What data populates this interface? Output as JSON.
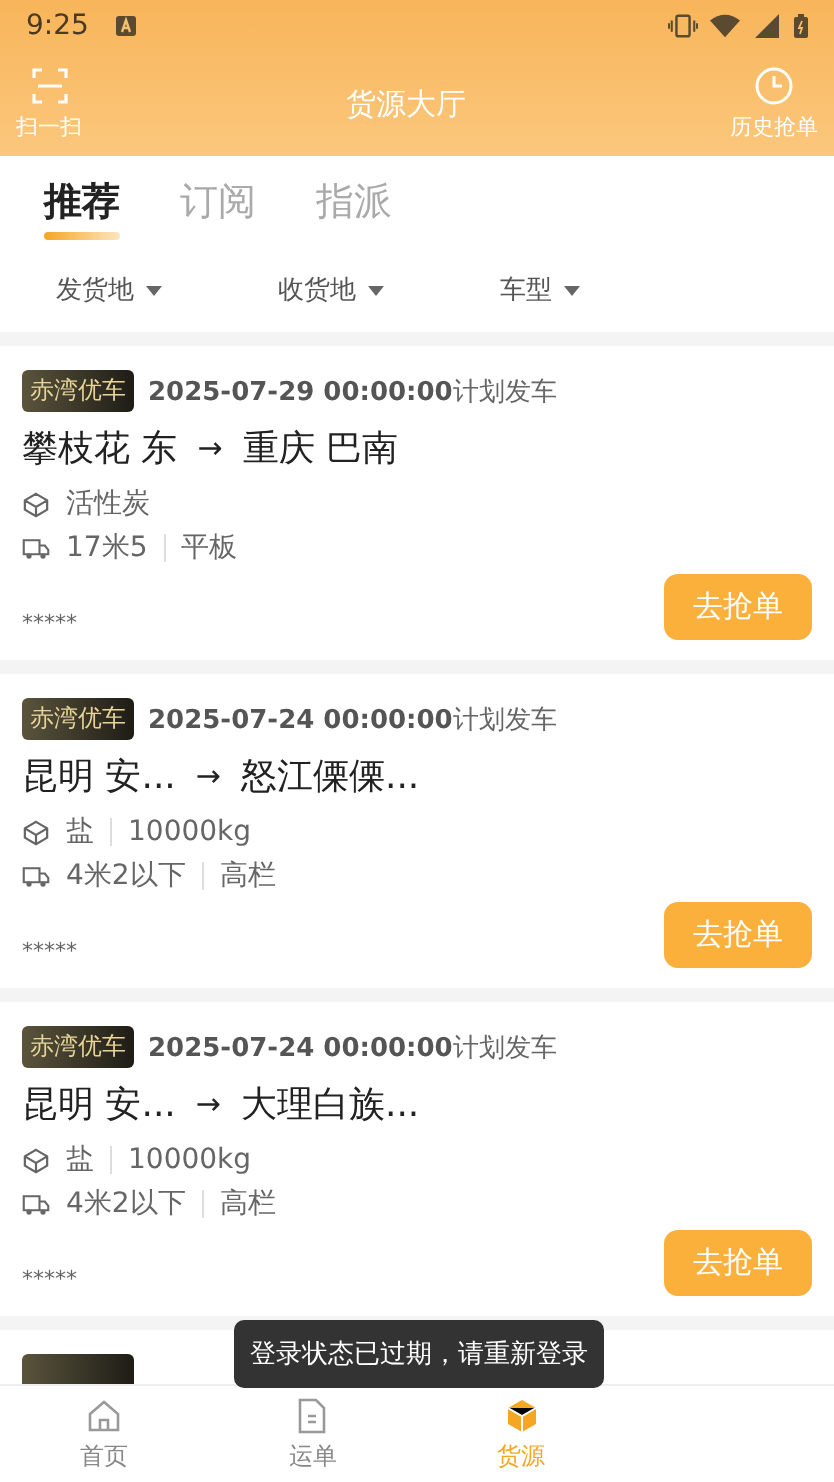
{
  "status_bar": {
    "time": "9:25"
  },
  "header": {
    "title": "货源大厅",
    "left_action": "扫一扫",
    "right_action": "历史抢单"
  },
  "tabs": [
    {
      "label": "推荐",
      "selected": true
    },
    {
      "label": "订阅",
      "selected": false
    },
    {
      "label": "指派",
      "selected": false
    }
  ],
  "filters": [
    "发货地",
    "收货地",
    "车型"
  ],
  "cards": [
    {
      "tag": "赤湾优车",
      "date": "2025-07-29 00:00:00",
      "date_suffix": "计划发车",
      "from": "攀枝花 东",
      "arrow": "→",
      "to": "重庆 巴南",
      "cargo": [
        "活性炭"
      ],
      "vehicle": [
        "17米5",
        "平板"
      ],
      "masked": "*****",
      "button": "去抢单"
    },
    {
      "tag": "赤湾优车",
      "date": "2025-07-24 00:00:00",
      "date_suffix": "计划发车",
      "from": "昆明 安...",
      "arrow": "→",
      "to": "怒江傈傈...",
      "cargo": [
        "盐",
        "10000kg"
      ],
      "vehicle": [
        "4米2以下",
        "高栏"
      ],
      "masked": "*****",
      "button": "去抢单"
    },
    {
      "tag": "赤湾优车",
      "date": "2025-07-24 00:00:00",
      "date_suffix": "计划发车",
      "from": "昆明 安...",
      "arrow": "→",
      "to": "大理白族...",
      "cargo": [
        "盐",
        "10000kg"
      ],
      "vehicle": [
        "4米2以下",
        "高栏"
      ],
      "masked": "*****",
      "button": "去抢单"
    }
  ],
  "nav": [
    {
      "label": "首页",
      "kind": "home",
      "selected": false
    },
    {
      "label": "运单",
      "kind": "document",
      "selected": false
    },
    {
      "label": "货源",
      "kind": "box",
      "selected": true
    }
  ],
  "toast": "登录状态已过期，请重新登录"
}
